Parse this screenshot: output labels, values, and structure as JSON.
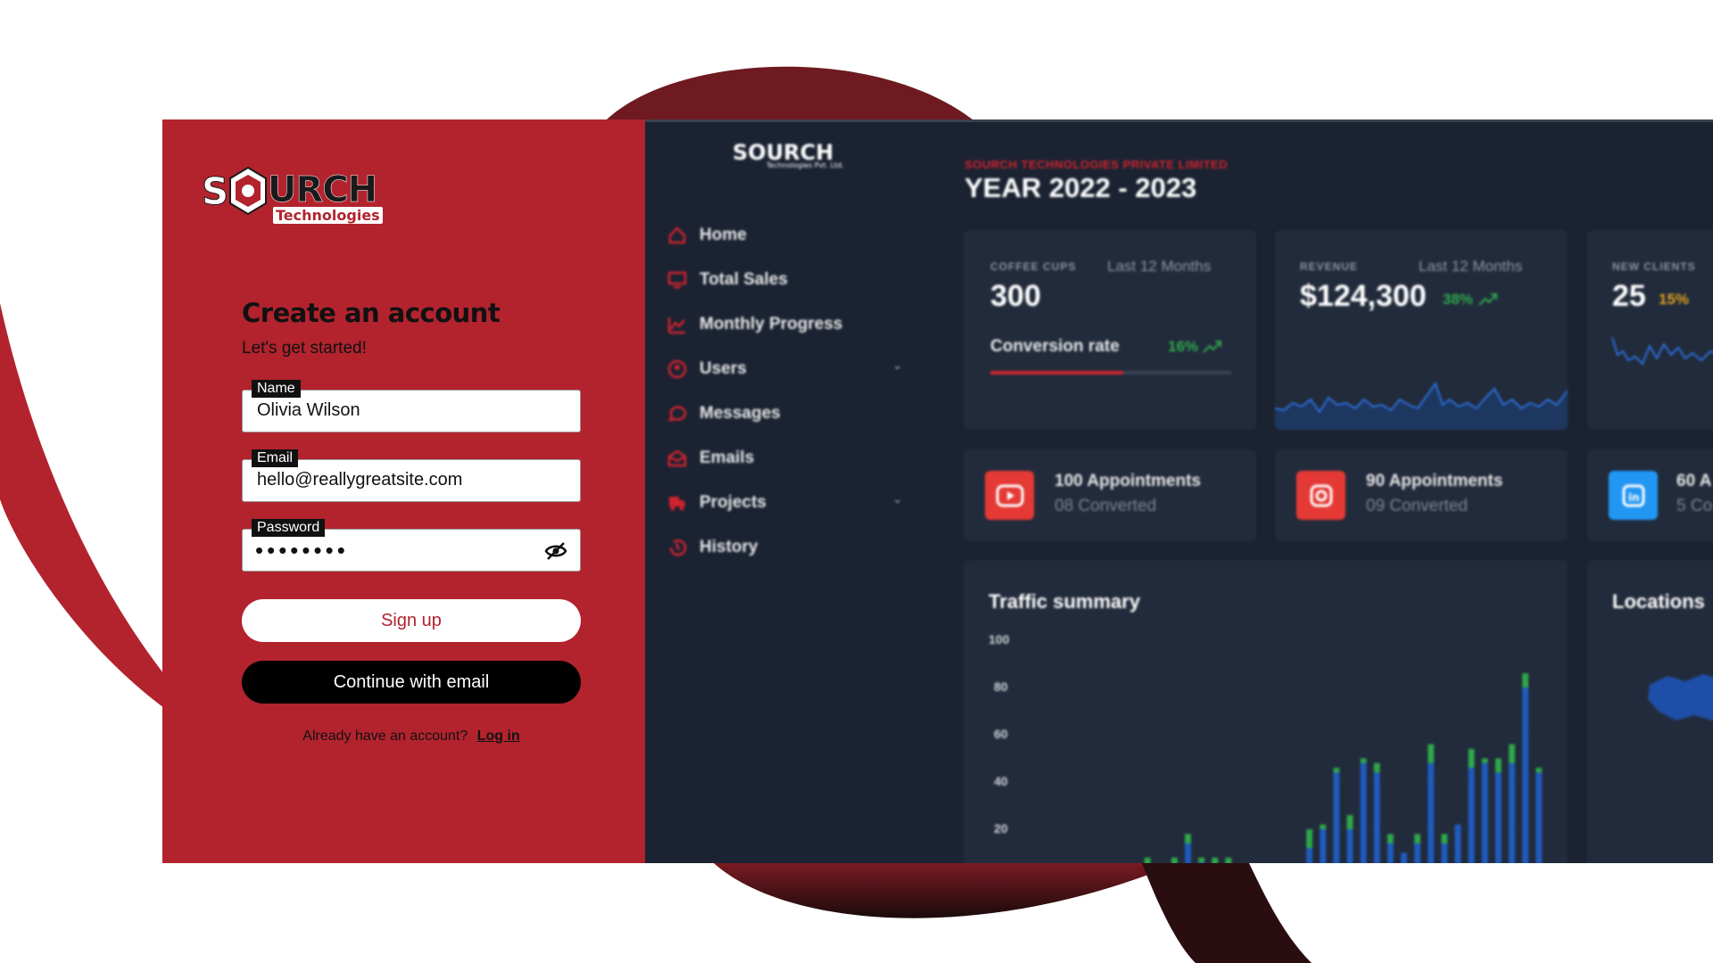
{
  "signup": {
    "logo_s": "S",
    "logo_urch": "URCH",
    "logo_sub": "Technologies",
    "title": "Create an account",
    "subtitle": "Let's get started!",
    "fields": [
      {
        "label": "Name",
        "value": "Olivia Wilson"
      },
      {
        "label": "Email",
        "value": "hello@reallygreatsite.com"
      },
      {
        "label": "Password",
        "value": "••••••••"
      }
    ],
    "signup_button": "Sign up",
    "email_button": "Continue with email",
    "already_text": "Already have an account?",
    "login_link": "Log in",
    "accent": "#b2232e"
  },
  "dashboard": {
    "logo": "SOURCH",
    "logo_small": "Technologies Pvt. Ltd.",
    "company": "SOURCH TECHNOLOGIES PRIVATE LIMITED",
    "year": "YEAR 2022 - 2023",
    "nav": [
      {
        "label": "Home",
        "icon": "home-icon"
      },
      {
        "label": "Total Sales",
        "icon": "monitor-icon"
      },
      {
        "label": "Monthly Progress",
        "icon": "chart-icon"
      },
      {
        "label": "Users",
        "icon": "user-icon",
        "chevron": "⌄"
      },
      {
        "label": "Messages",
        "icon": "message-icon"
      },
      {
        "label": "Emails",
        "icon": "envelope-icon"
      },
      {
        "label": "Projects",
        "icon": "truck-icon",
        "chevron": "⌄"
      },
      {
        "label": "History",
        "icon": "history-icon"
      }
    ],
    "cards": [
      {
        "label": "COFFEE CUPS",
        "period": "Last 12 Months",
        "value": "300",
        "sub_label": "Conversion rate",
        "pct": "16%",
        "progress": 0.55
      },
      {
        "label": "REVENUE",
        "period": "Last 12 Months",
        "value": "$124,300",
        "pct": "38%"
      },
      {
        "label": "NEW CLIENTS",
        "value": "25",
        "pct": "15%"
      }
    ],
    "appointments": [
      {
        "title": "100 Appointments",
        "sub": "08 Converted",
        "icon": "youtube-icon",
        "color": "#e53935"
      },
      {
        "title": "90 Appointments",
        "sub": "09 Converted",
        "icon": "instagram-icon",
        "color": "#e53935"
      },
      {
        "title": "60 A",
        "sub": "5 Co",
        "icon": "linkedin-icon",
        "color": "#2196f3"
      }
    ],
    "traffic_title": "Traffic summary",
    "locations_title": "Locations"
  },
  "chart_data": {
    "type": "bar",
    "title": "Traffic summary",
    "yticks": [
      "100",
      "80",
      "60",
      "40",
      "20"
    ],
    "ylim": [
      0,
      100
    ],
    "series": [
      {
        "color": "#1f5bbf"
      },
      {
        "color": "#2ea84a"
      }
    ],
    "blue": [
      0,
      0,
      0,
      0,
      0,
      0,
      0,
      0,
      0,
      4,
      0,
      4,
      14,
      6,
      3,
      4,
      0,
      0,
      0,
      0,
      0,
      12,
      20,
      44,
      20,
      48,
      44,
      14,
      10,
      14,
      48,
      14,
      22,
      46,
      48,
      44,
      48,
      80,
      44
    ],
    "green": [
      0,
      0,
      0,
      0,
      0,
      0,
      0,
      0,
      0,
      4,
      0,
      4,
      4,
      2,
      5,
      4,
      0,
      0,
      0,
      0,
      0,
      8,
      2,
      2,
      6,
      2,
      4,
      4,
      0,
      4,
      8,
      4,
      0,
      8,
      2,
      6,
      8,
      6,
      2
    ]
  }
}
